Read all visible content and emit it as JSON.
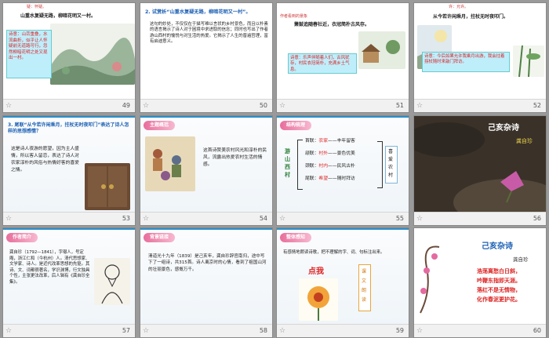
{
  "slides": [
    {
      "num": "49",
      "line1": "山重水复疑无路，柳暗花明又一村。",
      "top_note": "疑：怀疑。",
      "hl": "诗意：山峦重叠，水流曲折，似乎让人怀疑前无道路可行，忽然柳暗花明之处又现出一村。"
    },
    {
      "num": "50",
      "title": "2. 试赏析“山重水复疑无路，柳暗花明又一村”。",
      "body": "这句的妙处，不仅仅在于描写难以言状的乡村景色，而且以朴素的语言揭示了诗人对于困境中求进取的信念；同时也写出了作者游山西村的愉悦与对生活的热爱。它揭示了人生的普遍哲理，富有启迪意义。"
    },
    {
      "num": "51",
      "line1": "箫鼓追随春社近，衣冠简朴古风存。",
      "top_note": "作者看到的景象",
      "hl": "诗意：乐声伴随着人们，古风犹存，村民衣冠简朴，充满乡土气息。"
    },
    {
      "num": "52",
      "line1": "从今若许闲乘月，拄杖无时夜叩门。",
      "top_note": "许：允许。",
      "hl": "诗意：今后如果允许我乘月出游，我会拄着拐杖随时来敲门拜访。"
    },
    {
      "num": "53",
      "title": "3. 尾联“从今若许闲乘月，拄杖无时夜叩门”表达了诗人怎样的思想感情？",
      "body": "这是诗人夜游的愿望，因为主人盛情，所以客人留恋，表达了诗人对农家淳朴的风俗与热情好客的喜爱之情。"
    },
    {
      "num": "54",
      "label": "主题概括",
      "body": "这首诗赞美农村风光和淳朴的民风，流露出热爱农村生活的情感。"
    },
    {
      "num": "55",
      "label": "结构梳理",
      "center": "游山西村",
      "rows": [
        {
          "k": "首联：",
          "a": "农家",
          "b": "——丰年留客"
        },
        {
          "k": "颔联：",
          "a": "村外",
          "b": "——景色优美"
        },
        {
          "k": "颈联：",
          "a": "村内",
          "b": "——民风古朴"
        },
        {
          "k": "尾联：",
          "a": "希望",
          "b": "——随时拜访"
        }
      ],
      "right": "喜爱农村"
    },
    {
      "num": "56",
      "title": "己亥杂诗",
      "sub": "龚自珍"
    },
    {
      "num": "57",
      "label": "作者简介",
      "body": "龚自珍（1792—1841），字璱人，号定庵，浙江仁和（今杭州）人。清代思想家、文学家、诗人。是近代改革思想的先驱。其诗、文、词都很著名，学识渊博，行文独具个性，主张更法改革，后人辑有《龚自珍全集》。"
    },
    {
      "num": "58",
      "label": "背景链接",
      "body": "清道光十九年（1839）是己亥年，龚自珍辞官南归，途中写下了一组诗，共315首。诗人离京时的心情，看到了祖国山河的壮丽景色，感慨万千。"
    },
    {
      "num": "59",
      "label": "整体感知",
      "body": "有感情地朗读诗歌，把不理解的字、词、句标注出来。",
      "btn": "点我",
      "side": "课文朗读"
    },
    {
      "num": "60",
      "title": "己亥杂诗",
      "author": "龚自珍",
      "lines": [
        "浩荡离愁白日斜，",
        "吟鞭东指即天涯。",
        "落红不是无情物，",
        "化作春泥更护花。"
      ]
    }
  ]
}
